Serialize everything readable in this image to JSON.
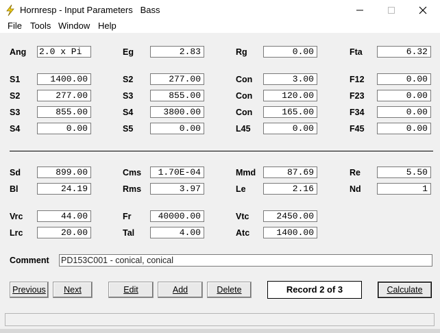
{
  "window": {
    "title": "Hornresp - Input Parameters   Bass"
  },
  "menu": [
    "File",
    "Tools",
    "Window",
    "Help"
  ],
  "params": {
    "Ang": {
      "label": "Ang",
      "value": "2.0 x Pi"
    },
    "Eg": {
      "label": "Eg",
      "value": "2.83"
    },
    "Rg": {
      "label": "Rg",
      "value": "0.00"
    },
    "Fta": {
      "label": "Fta",
      "value": "6.32"
    },
    "S1_a": {
      "label": "S1",
      "value": "1400.00"
    },
    "S2_a": {
      "label": "S2",
      "value": "277.00"
    },
    "Con1": {
      "label": "Con",
      "value": "3.00"
    },
    "F12": {
      "label": "F12",
      "value": "0.00"
    },
    "S2_b": {
      "label": "S2",
      "value": "277.00"
    },
    "S3_a": {
      "label": "S3",
      "value": "855.00"
    },
    "Con2": {
      "label": "Con",
      "value": "120.00"
    },
    "F23": {
      "label": "F23",
      "value": "0.00"
    },
    "S3_b": {
      "label": "S3",
      "value": "855.00"
    },
    "S4_a": {
      "label": "S4",
      "value": "3800.00"
    },
    "Con3": {
      "label": "Con",
      "value": "165.00"
    },
    "F34": {
      "label": "F34",
      "value": "0.00"
    },
    "S4_b": {
      "label": "S4",
      "value": "0.00"
    },
    "S5": {
      "label": "S5",
      "value": "0.00"
    },
    "L45": {
      "label": "L45",
      "value": "0.00"
    },
    "F45": {
      "label": "F45",
      "value": "0.00"
    },
    "Sd": {
      "label": "Sd",
      "value": "899.00"
    },
    "Cms": {
      "label": "Cms",
      "value": "1.70E-04"
    },
    "Mmd": {
      "label": "Mmd",
      "value": "87.69"
    },
    "Re": {
      "label": "Re",
      "value": "5.50"
    },
    "Bl": {
      "label": "Bl",
      "value": "24.19"
    },
    "Rms": {
      "label": "Rms",
      "value": "3.97"
    },
    "Le": {
      "label": "Le",
      "value": "2.16"
    },
    "Nd": {
      "label": "Nd",
      "value": "1"
    },
    "Vrc": {
      "label": "Vrc",
      "value": "44.00"
    },
    "Fr": {
      "label": "Fr",
      "value": "40000.00"
    },
    "Vtc": {
      "label": "Vtc",
      "value": "2450.00"
    },
    "Lrc": {
      "label": "Lrc",
      "value": "20.00"
    },
    "Tal": {
      "label": "Tal",
      "value": "4.00"
    },
    "Atc": {
      "label": "Atc",
      "value": "1400.00"
    }
  },
  "comment": {
    "label": "Comment",
    "value": "PD153C001 - conical, conical"
  },
  "buttons": {
    "previous": "Previous",
    "next": "Next",
    "edit": "Edit",
    "add": "Add",
    "delete": "Delete",
    "calculate": "Calculate"
  },
  "record": "Record 2 of 3",
  "colors": {
    "icon_yellow": "#f2d21a",
    "background": "#f0f0f0"
  }
}
